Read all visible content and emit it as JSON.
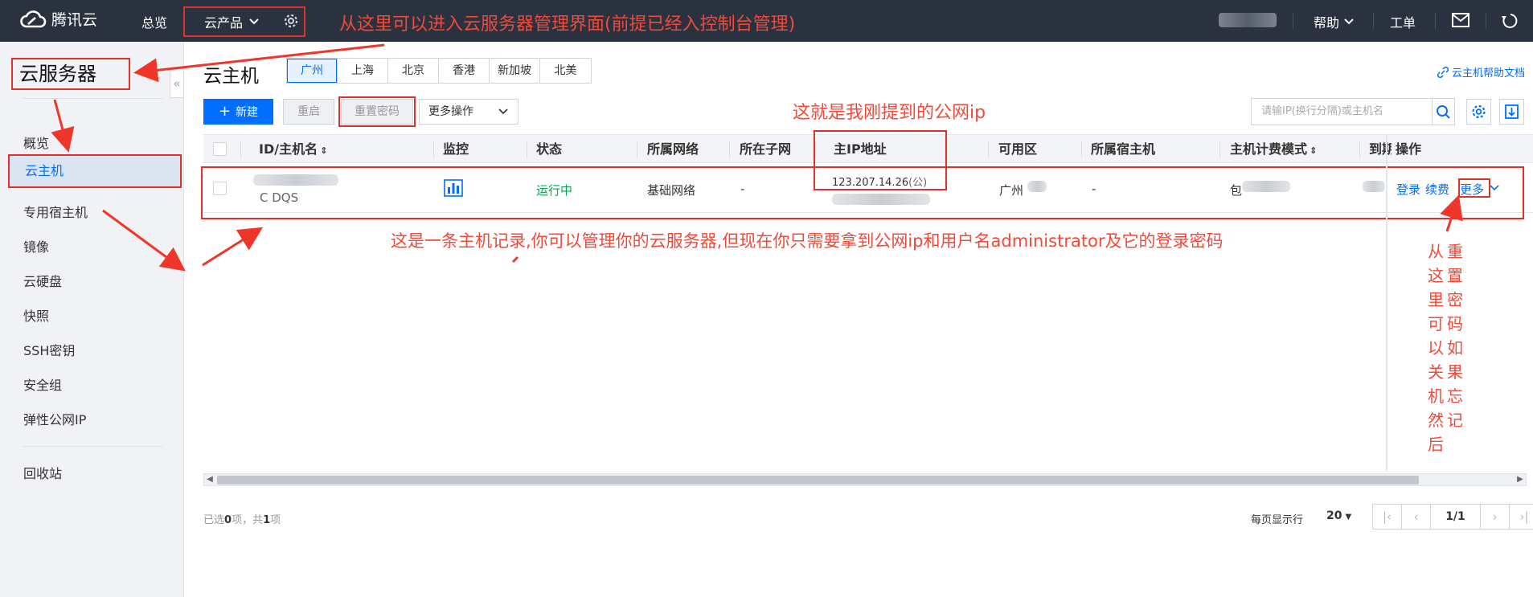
{
  "topbar": {
    "logo_text": "腾讯云",
    "overview": "总览",
    "products": "云产品",
    "help": "帮助",
    "ticket": "工单",
    "annotation": "从这里可以进入云服务器管理界面(前提已经入控制台管理)"
  },
  "sidebar": {
    "title": "云服务器",
    "items": [
      {
        "label": "概览"
      },
      {
        "label": "云主机"
      },
      {
        "label": "专用宿主机"
      },
      {
        "label": "镜像"
      },
      {
        "label": "云硬盘"
      },
      {
        "label": "快照"
      },
      {
        "label": "SSH密钥"
      },
      {
        "label": "安全组"
      },
      {
        "label": "弹性公网IP"
      },
      {
        "label": "回收站"
      }
    ]
  },
  "main": {
    "title": "云主机",
    "regions": [
      "广州",
      "上海",
      "北京",
      "香港",
      "新加坡",
      "北美"
    ],
    "help_link": "云主机帮助文档",
    "toolbar": {
      "new_label": "新建",
      "restart_label": "重启",
      "reset_password_label": "重置密码",
      "more_label": "更多操作"
    },
    "search_placeholder": "请输IP(换行分隔)或主机名",
    "ip_annotation": "这就是我刚提到的公网ip",
    "row_annotation": "这是一条主机记录,你可以管理你的云服务器,但现在你只需要拿到公网ip和用户名administrator及它的登录密码",
    "vertical_annotation_cols": [
      [
        "从",
        "这",
        "里",
        "可",
        "以",
        "关",
        "机",
        "然",
        "后"
      ],
      [
        "重",
        "置",
        "密",
        "码",
        "如",
        "果",
        "忘",
        "记"
      ]
    ]
  },
  "table": {
    "headers": {
      "id": "ID/主机名",
      "monitor": "监控",
      "status": "状态",
      "network": "所属网络",
      "subnet": "所在子网",
      "ip": "主IP地址",
      "zone": "可用区",
      "host": "所属宿主机",
      "billing": "主机计费模式",
      "expire": "到期",
      "ops": "操作"
    },
    "row": {
      "id_partial": "C  DQS",
      "status": "运行中",
      "network": "基础网络",
      "subnet": "-",
      "ip_public": "123.207.14.26",
      "ip_public_suffix": "(公)",
      "zone_partial": "广州",
      "host": "-",
      "billing_partial": "包",
      "op_login": "登录",
      "op_renew": "续费",
      "op_more": "更多"
    }
  },
  "footer": {
    "selected_prefix": "已选",
    "selected_count": "0",
    "selected_mid": "项，共",
    "total_count": "1",
    "selected_suffix": "项",
    "per_page_label": "每页显示行",
    "per_page_value": "20",
    "page_indicator": "1/1"
  },
  "colors": {
    "topbar_bg": "#2a3240",
    "accent": "#006eff",
    "running_green": "#00a84d",
    "annotation_red": "#f04a3a"
  }
}
